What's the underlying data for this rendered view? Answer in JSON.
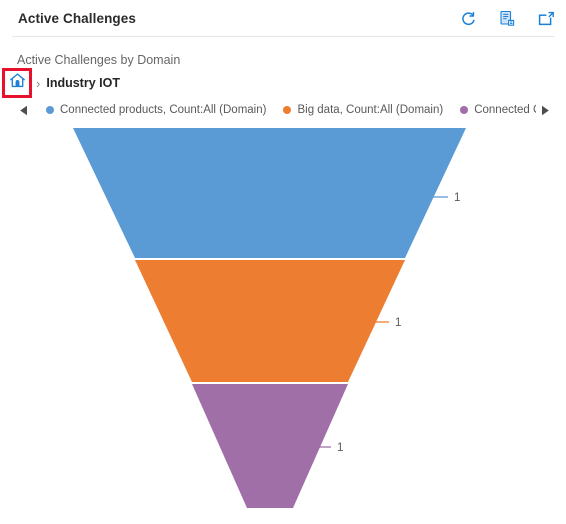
{
  "header": {
    "title": "Active Challenges",
    "actions": [
      {
        "name": "refresh-icon",
        "label": "Refresh"
      },
      {
        "name": "export-icon",
        "label": "Export"
      },
      {
        "name": "popout-icon",
        "label": "Open in new window"
      }
    ]
  },
  "chart_title": "Active Challenges by Domain",
  "breadcrumb": {
    "home_label": "Home",
    "separator": "›",
    "current": "Industry IOT",
    "highlight_color": "#e8112d"
  },
  "legend": {
    "prev_label": "◀",
    "next_label": "▶",
    "items": [
      {
        "label": "Connected products, Count:All (Domain)",
        "color": "#5b9bd5"
      },
      {
        "label": "Big data, Count:All (Domain)",
        "color": "#ed7d31"
      },
      {
        "label": "Connected Opera",
        "color": "#a06fa8"
      }
    ]
  },
  "chart_data": {
    "type": "funnel",
    "title": "Active Challenges by Domain",
    "xlabel": "",
    "ylabel": "",
    "categories": [
      "Connected products, Count:All (Domain)",
      "Big data, Count:All (Domain)",
      "Connected Opera"
    ],
    "values": [
      1,
      1,
      1
    ],
    "data_labels": [
      "1",
      "1",
      "1"
    ],
    "colors": [
      "#5b9bd5",
      "#ed7d31",
      "#a06fa8"
    ],
    "legend_position": "top",
    "grid": false
  }
}
